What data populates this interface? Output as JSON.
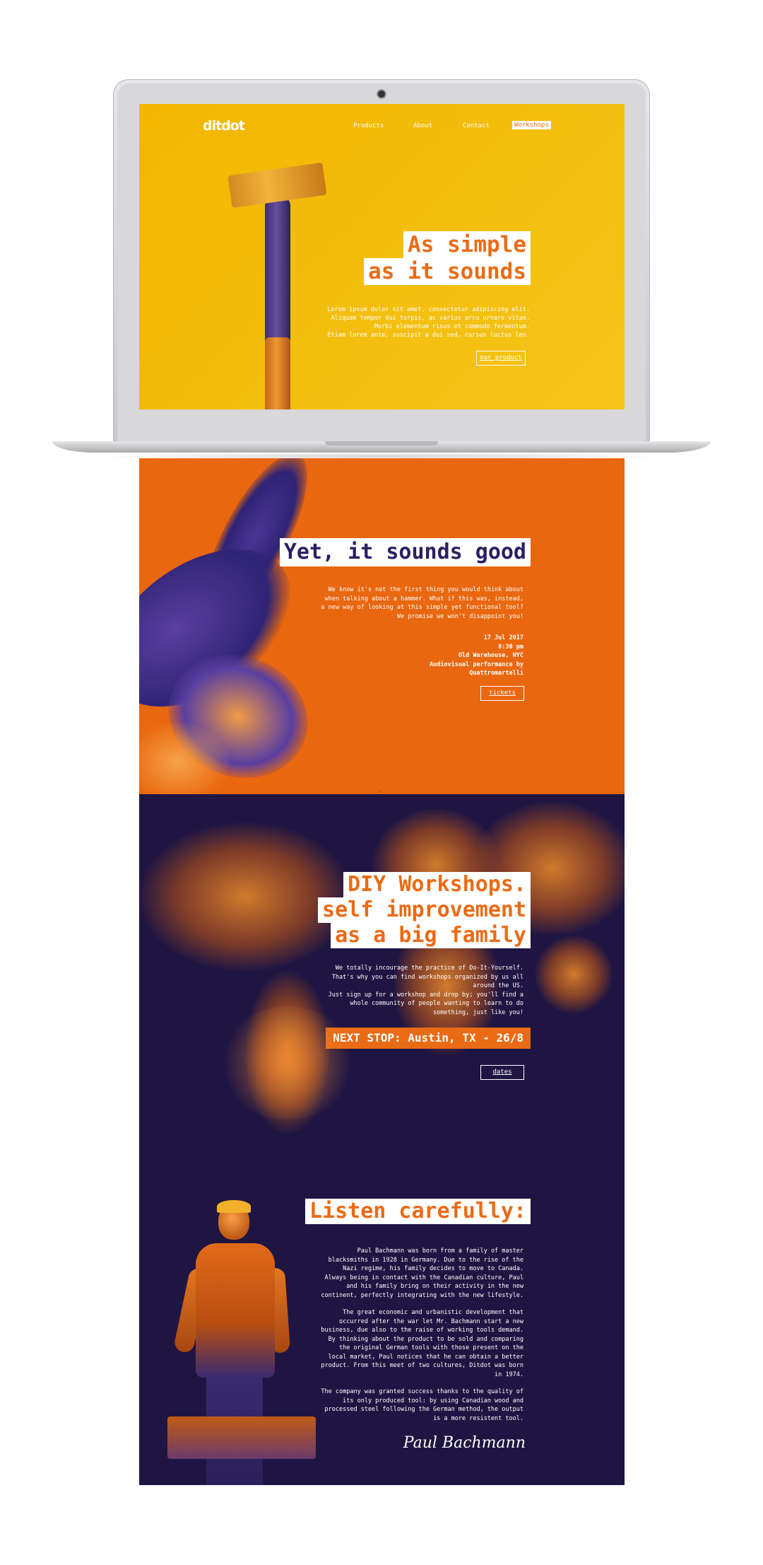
{
  "colors": {
    "yellow": "#f2b600",
    "orange": "#e9670f",
    "navy": "#1f1542",
    "white": "#ffffff"
  },
  "header": {
    "logo": "ditdot",
    "nav": [
      "Products",
      "About",
      "Contact",
      "Workshops"
    ],
    "active_nav": "Workshops"
  },
  "hero": {
    "title_line1": "As simple",
    "title_line2": "as it sounds",
    "text": [
      "Lorem ipsum dolor sit amet, consectetur adipiscing elit.",
      "Aliquam tempor dui turpis, ac varius arcu ornare vitae.",
      "Morbi elementum risus et commodo fermentum.",
      "Etiam lorem ante, suscipit a dui sed, cursus luctus leo."
    ],
    "button": "our product"
  },
  "event": {
    "title": "Yet, it sounds good",
    "text": [
      "We know it's not the first thing you would think about",
      "when talking about a hammer. What if this was, instead,",
      "a new way of looking at this simple yet functional tool?",
      "We promise we won't disappoint you!"
    ],
    "date": "17 Jul 2017",
    "time": "8:30 pm",
    "venue": "Old Warehouse, NYC",
    "performance": "Audiovisual performance by",
    "performer": "Quattromartelli",
    "button": "tickets",
    "scroll_icon": "chevron-down-icon"
  },
  "workshops": {
    "title_line1": "DIY Workshops.",
    "title_line2": "self improvement",
    "title_line3": "as a big family",
    "text": [
      "We totally incourage the practice of Do-It-Yourself.",
      "That's why you can find workshops organized by us all",
      "around the US.",
      "Just sign up for a workshop and drop by; you'll find a",
      "whole community of people wanting to learn to do",
      "something, just like you!"
    ],
    "next_stop": "NEXT STOP: Austin, TX - 26/8",
    "button": "dates"
  },
  "story": {
    "title": "Listen carefully:",
    "p1": [
      "Paul Bachmann was born from a family of master",
      "blacksmiths in 1928 in Germany. Due to the rise of the",
      "Nazi regime, his family decides to move to Canada.",
      "Always being in contact with the Canadian culture, Paul",
      "and his family bring on their activity in the new",
      "continent, perfectly integrating with the new lifestyle."
    ],
    "p2": [
      "The great economic and urbanistic development that",
      "occurred after the war let Mr. Bachmann start a new",
      "business, due also to the raise of working tools demand.",
      "By thinking about the product to be sold and comparing",
      "the original German tools with those present on the",
      "local market, Paul notices that he can obtain a better",
      "product. From this meet of two cultures, Ditdot was born",
      "in 1974."
    ],
    "p3": [
      "The company was granted success thanks to the quality of",
      "its only produced tool: by using Canadian wood and",
      "processed steel following the German method, the output",
      "is a more resistent tool."
    ],
    "signature": "Paul Bachmann"
  }
}
